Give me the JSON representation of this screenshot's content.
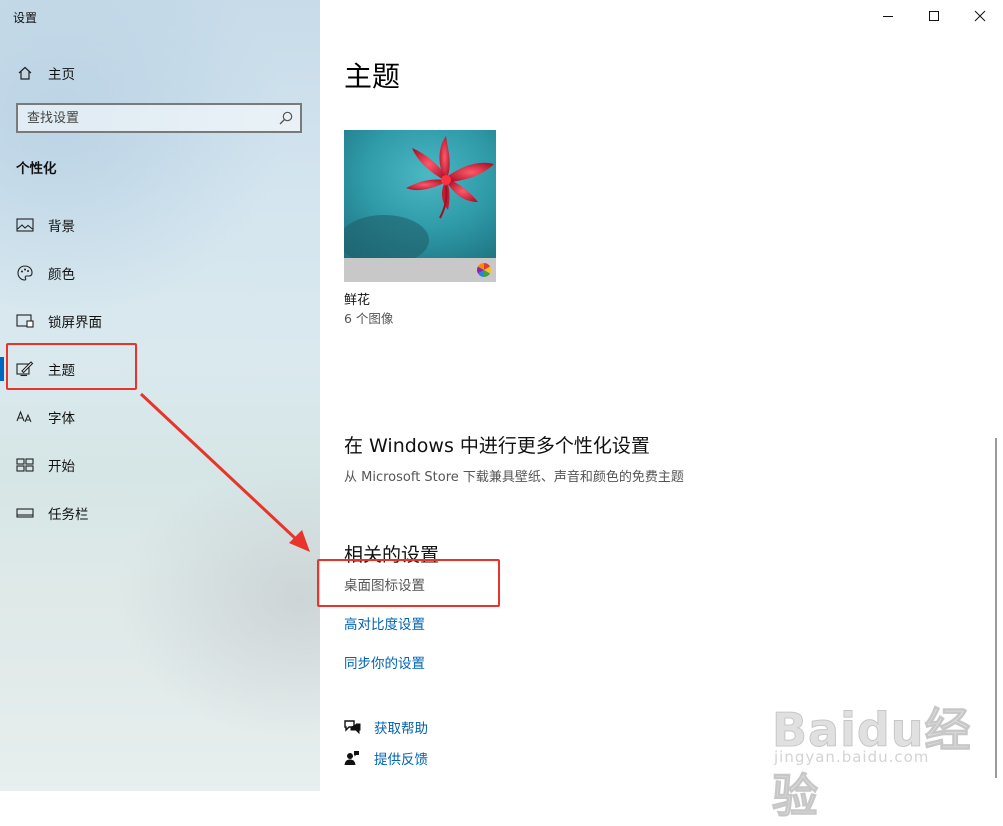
{
  "window": {
    "app_title": "设置"
  },
  "sidebar": {
    "home_label": "主页",
    "search_placeholder": "查找设置",
    "section_heading": "个性化",
    "items": [
      {
        "label": "背景",
        "icon": "picture-icon"
      },
      {
        "label": "颜色",
        "icon": "palette-icon"
      },
      {
        "label": "锁屏界面",
        "icon": "lock-screen-icon"
      },
      {
        "label": "主题",
        "icon": "theme-brush-icon",
        "selected": true
      },
      {
        "label": "字体",
        "icon": "font-icon"
      },
      {
        "label": "开始",
        "icon": "start-menu-icon"
      },
      {
        "label": "任务栏",
        "icon": "taskbar-icon"
      }
    ]
  },
  "main": {
    "title": "主题",
    "theme": {
      "name": "鲜花",
      "count": "6 个图像"
    },
    "more_section": {
      "heading": "在 Windows 中进行更多个性化设置",
      "description": "从 Microsoft Store 下载兼具壁纸、声音和颜色的免费主题"
    },
    "related": {
      "heading": "相关的设置",
      "links": [
        "桌面图标设置",
        "高对比度设置",
        "同步你的设置"
      ]
    },
    "help": {
      "get_help": "获取帮助",
      "feedback": "提供反馈"
    }
  },
  "watermark": {
    "text": "Baidu经验",
    "sub": "jingyan.baidu.com"
  },
  "colors": {
    "accent": "#0063b1",
    "selection_bar": "#0067c0",
    "annotation_red": "#e8342b"
  }
}
